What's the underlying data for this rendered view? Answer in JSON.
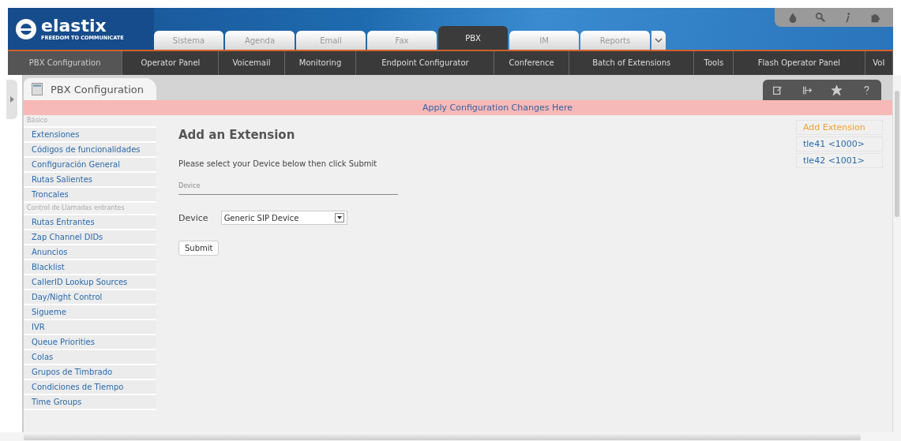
{
  "header": {
    "logo": "elastix",
    "tagline": "FREEDOM TO COMMUNICATE"
  },
  "main_tabs": [
    {
      "label": "Sistema",
      "selected": false
    },
    {
      "label": "Agenda",
      "selected": false
    },
    {
      "label": "Email",
      "selected": false
    },
    {
      "label": "Fax",
      "selected": false
    },
    {
      "label": "PBX",
      "selected": true
    },
    {
      "label": "IM",
      "selected": false
    },
    {
      "label": "Reports",
      "selected": false
    }
  ],
  "submenu": [
    {
      "label": "PBX Configuration",
      "selected": true
    },
    {
      "label": "Operator Panel",
      "selected": false
    },
    {
      "label": "Voicemail",
      "selected": false
    },
    {
      "label": "Monitoring",
      "selected": false
    },
    {
      "label": "Endpoint Configurator",
      "selected": false
    },
    {
      "label": "Conference",
      "selected": false
    },
    {
      "label": "Batch of Extensions",
      "selected": false
    },
    {
      "label": "Tools",
      "selected": false
    },
    {
      "label": "Flash Operator Panel",
      "selected": false
    },
    {
      "label": "VoI",
      "selected": false
    }
  ],
  "page_tab": {
    "label": "PBX Configuration"
  },
  "notice": "Apply Configuration Changes Here",
  "sidebar": [
    {
      "kind": "heading",
      "label": "Básico"
    },
    {
      "kind": "link",
      "label": "Extensiones"
    },
    {
      "kind": "link",
      "label": "Códigos de funcionalidades"
    },
    {
      "kind": "link",
      "label": "Configuración General"
    },
    {
      "kind": "link",
      "label": "Rutas Salientes"
    },
    {
      "kind": "link",
      "label": "Troncales"
    },
    {
      "kind": "heading",
      "label": "Control de Llamadas entrantes"
    },
    {
      "kind": "link",
      "label": "Rutas Entrantes"
    },
    {
      "kind": "link",
      "label": "Zap Channel DIDs"
    },
    {
      "kind": "link",
      "label": "Anuncios"
    },
    {
      "kind": "link",
      "label": "Blacklist"
    },
    {
      "kind": "link",
      "label": "CallerID Lookup Sources"
    },
    {
      "kind": "link",
      "label": "Day/Night Control"
    },
    {
      "kind": "link",
      "label": "Sigueme"
    },
    {
      "kind": "link",
      "label": "IVR"
    },
    {
      "kind": "link",
      "label": "Queue Priorities"
    },
    {
      "kind": "link",
      "label": "Colas"
    },
    {
      "kind": "link",
      "label": "Grupos de Timbrado"
    },
    {
      "kind": "link",
      "label": "Condiciones de Tiempo"
    },
    {
      "kind": "link",
      "label": "Time Groups"
    }
  ],
  "form": {
    "title": "Add an Extension",
    "instructions": "Please select your Device below then click Submit",
    "section": "Device",
    "device_label": "Device",
    "device_value": "Generic SIP Device",
    "submit": "Submit"
  },
  "extensions": [
    {
      "label": "Add Extension",
      "selected": true
    },
    {
      "label": "tle41 <1000>",
      "selected": false
    },
    {
      "label": "tle42 <1001>",
      "selected": false
    }
  ]
}
